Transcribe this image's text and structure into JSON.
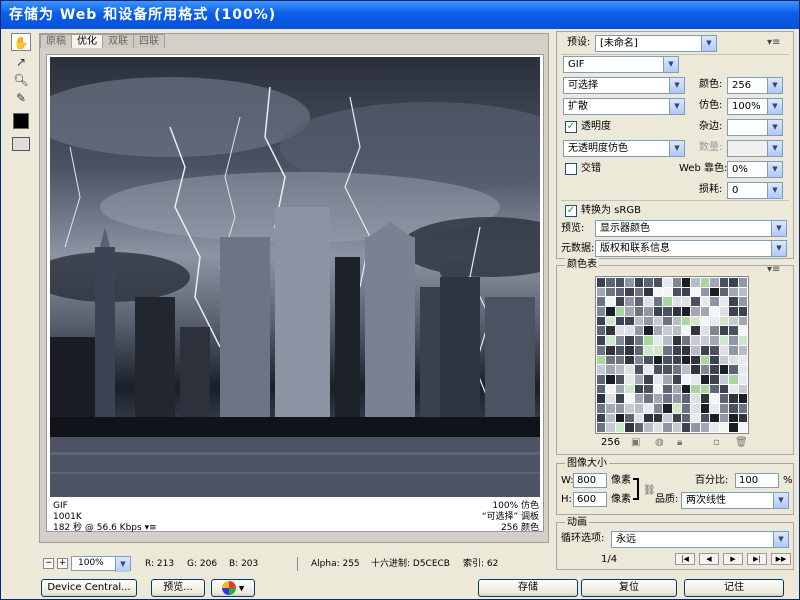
{
  "window": {
    "title": "存储为 Web 和设备所用格式 (100%)"
  },
  "tabs": [
    "原稿",
    "优化",
    "双联",
    "四联"
  ],
  "image_info": {
    "format": "GIF",
    "size": "1001K",
    "time": "182 秒 @ 56.6 Kbps",
    "dither_pct": "100% 仿色",
    "palette": "“可选择” 调板",
    "colors": "256 颜色"
  },
  "status_bar": {
    "zoom": "100%",
    "r": "R: 213",
    "g": "G: 206",
    "b": "B: 203",
    "alpha": "Alpha: 255",
    "hex": "十六进制: D5CECB",
    "index": "索引: 62"
  },
  "settings": {
    "preset_label": "预设:",
    "preset_value": "[未命名]",
    "format_value": "GIF",
    "reduction_value": "可选择",
    "colors_label": "颜色:",
    "colors_value": "256",
    "dither_algo_value": "扩散",
    "dither_label": "仿色:",
    "dither_value": "100%",
    "transparency_label": "透明度",
    "matte_label": "杂边:",
    "matte_value": "",
    "transparency_dither_value": "无透明度仿色",
    "amount_label": "数量:",
    "amount_value": "",
    "interlaced_label": "交错",
    "web_snap_label": "Web 靠色:",
    "web_snap_value": "0%",
    "lossy_label": "损耗:",
    "lossy_value": "0",
    "convert_srgb_label": "转换为 sRGB",
    "preview_label": "预览:",
    "preview_value": "显示器颜色",
    "metadata_label": "元数据:",
    "metadata_value": "版权和联系信息"
  },
  "color_table": {
    "title": "颜色表",
    "count": "256"
  },
  "image_size": {
    "title": "图像大小",
    "w_label": "W:",
    "w_value": "800",
    "h_label": "H:",
    "h_value": "600",
    "unit": "像素",
    "percent_label": "百分比:",
    "percent_value": "100",
    "percent_unit": "%",
    "quality_label": "品质:",
    "quality_value": "两次线性"
  },
  "animation": {
    "title": "动画",
    "loop_label": "循环选项:",
    "loop_value": "永远",
    "frame": "1/4"
  },
  "buttons": {
    "device_central": "Device Central...",
    "preview": "预览...",
    "save": "存储",
    "reset": "复位",
    "remember": "记住"
  },
  "colors": {
    "title_bar": "#0a5ee8",
    "panel_bg": "#ece9d8",
    "check_green": "#21a121"
  }
}
